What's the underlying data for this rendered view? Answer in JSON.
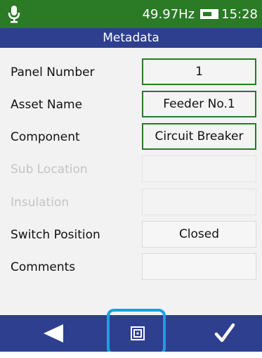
{
  "status_bar": {
    "frequency": "49.97Hz",
    "time": "15:28",
    "icons": [
      "microphone-icon",
      "battery-icon"
    ]
  },
  "title": "Metadata",
  "fields": [
    {
      "label": "Panel Number",
      "value": "1",
      "state": "active"
    },
    {
      "label": "Asset Name",
      "value": "Feeder No.1",
      "state": "active"
    },
    {
      "label": "Component",
      "value": "Circuit Breaker",
      "state": "active"
    },
    {
      "label": "Sub Location",
      "value": "",
      "state": "disabled"
    },
    {
      "label": "Insulation",
      "value": "",
      "state": "disabled"
    },
    {
      "label": "Switch Position",
      "value": "Closed",
      "state": "plain"
    },
    {
      "label": "Comments",
      "value": "",
      "state": "plain"
    }
  ],
  "bottom_nav": {
    "icons": [
      "back-arrow-icon",
      "fit-screen-icon",
      "checkmark-icon"
    ]
  },
  "colors": {
    "status_bar": "#2a7a26",
    "title_bar": "#2e3f8f",
    "active_border": "#2a7a26",
    "highlight": "#1aa0e0"
  }
}
